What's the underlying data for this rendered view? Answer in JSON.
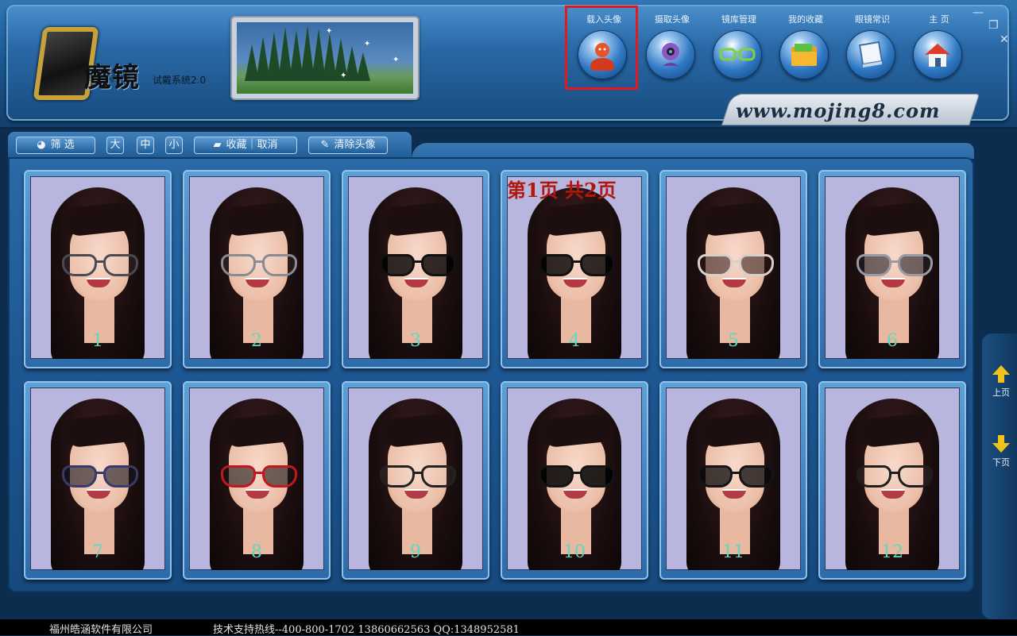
{
  "app": {
    "logo_title": "魔镜",
    "logo_subtitle": "试戴系统2.0",
    "website": "www.mojing8.com"
  },
  "nav": [
    {
      "label": "载入头像",
      "icon": "person-icon",
      "active": true
    },
    {
      "label": "摄取头像",
      "icon": "webcam-icon",
      "active": false
    },
    {
      "label": "镜库管理",
      "icon": "glasses-icon",
      "active": false
    },
    {
      "label": "我的收藏",
      "icon": "folder-icon",
      "active": false
    },
    {
      "label": "眼镜常识",
      "icon": "book-icon",
      "active": false
    },
    {
      "label": "主 页",
      "icon": "home-icon",
      "active": false
    }
  ],
  "toolbar": {
    "filter": "筛 选",
    "size_large": "大",
    "size_medium": "中",
    "size_small": "小",
    "favorite": "收藏｜取消",
    "clear_avatar": "清除头像"
  },
  "pagination": {
    "info": "第1页  共2页",
    "prev": "上页",
    "next": "下页"
  },
  "cards": [
    {
      "number": "1",
      "frame": "#4a4a52",
      "tint": "rgba(255,255,255,0.05)"
    },
    {
      "number": "2",
      "frame": "#8a8a92",
      "tint": "rgba(255,255,255,0.05)"
    },
    {
      "number": "3",
      "frame": "#111111",
      "tint": "rgba(0,0,0,0.8)"
    },
    {
      "number": "4",
      "frame": "#111111",
      "tint": "rgba(0,0,0,0.8)"
    },
    {
      "number": "5",
      "frame": "#d8d0c8",
      "tint": "rgba(40,20,20,0.55)"
    },
    {
      "number": "6",
      "frame": "#9a9aa4",
      "tint": "rgba(30,30,40,0.6)"
    },
    {
      "number": "7",
      "frame": "#3a3a6a",
      "tint": "rgba(20,20,30,0.6)"
    },
    {
      "number": "8",
      "frame": "#c4161c",
      "tint": "rgba(20,20,20,0.6)"
    },
    {
      "number": "9",
      "frame": "#222222",
      "tint": "rgba(255,255,255,0.05)"
    },
    {
      "number": "10",
      "frame": "#141414",
      "tint": "rgba(0,0,0,0.85)"
    },
    {
      "number": "11",
      "frame": "#141414",
      "tint": "rgba(10,10,10,0.75)"
    },
    {
      "number": "12",
      "frame": "#1e1e1e",
      "tint": "rgba(255,255,255,0.05)"
    }
  ],
  "footer": {
    "company": "福州皓涵软件有限公司",
    "support": "技术支持热线--400-800-1702 13860662563 QQ:1348952581"
  }
}
